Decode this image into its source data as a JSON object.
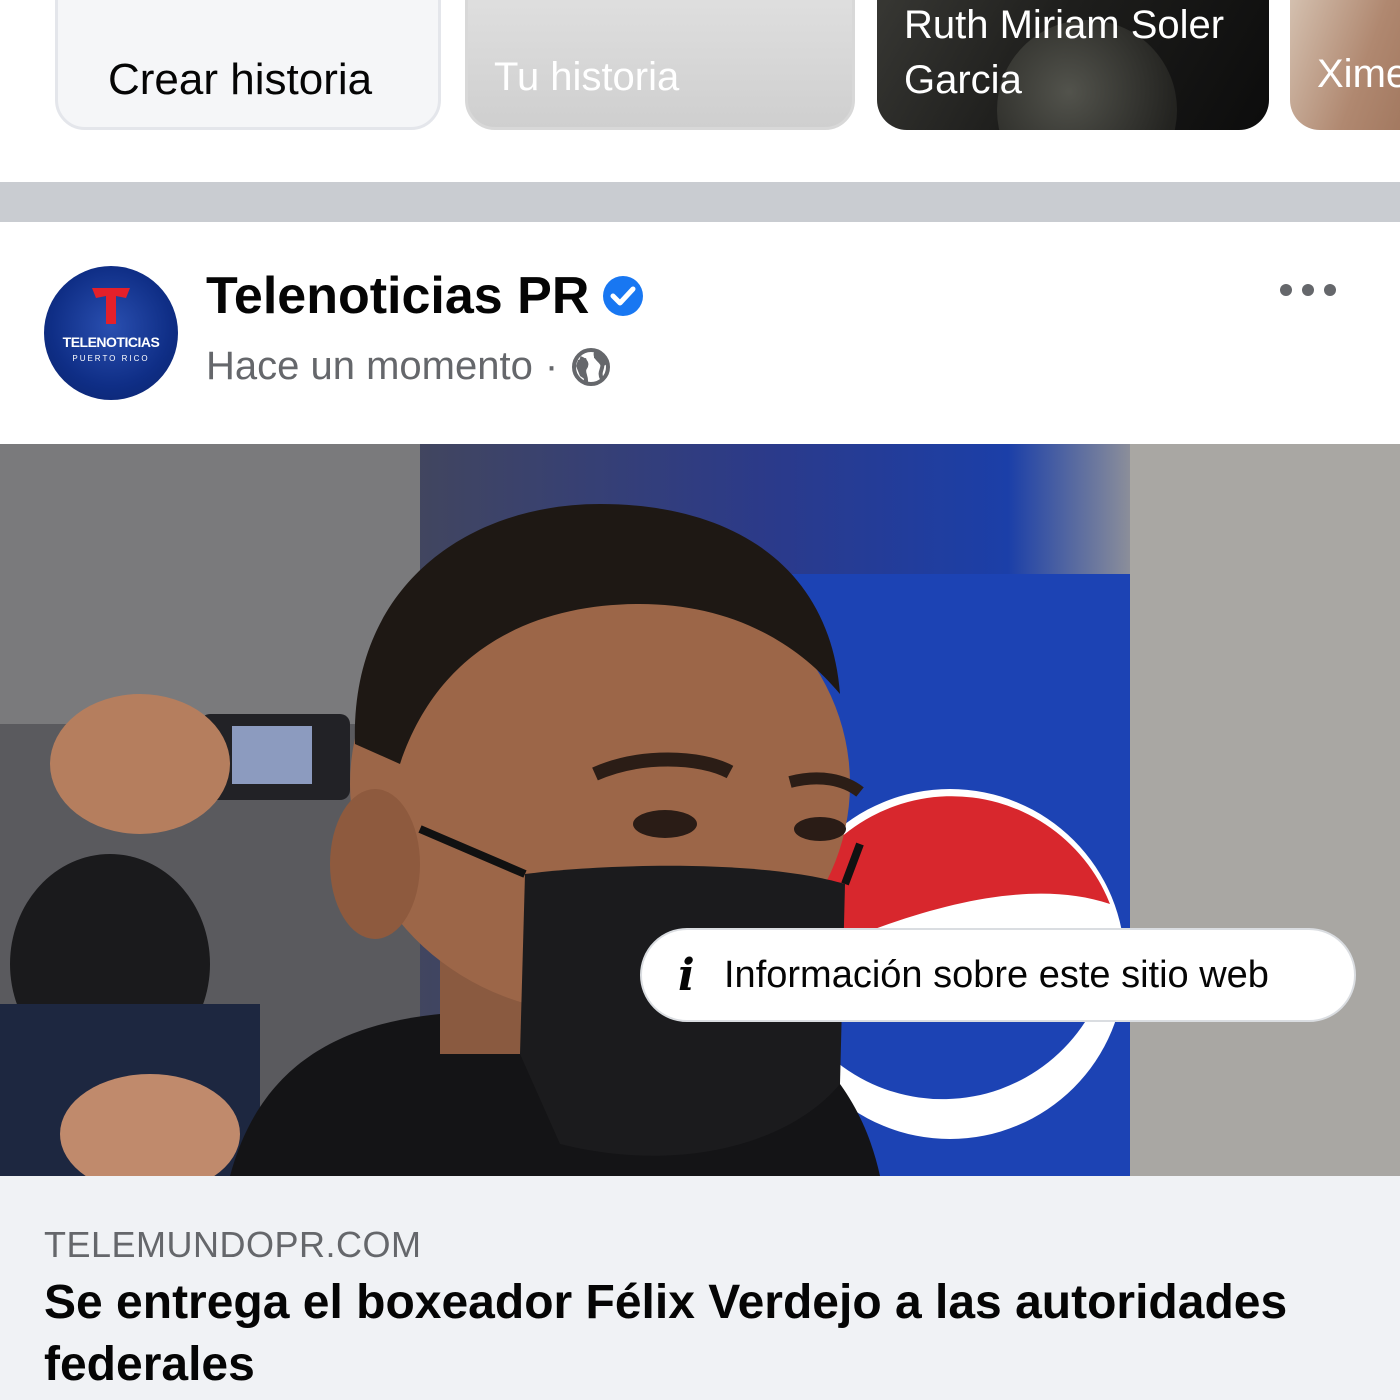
{
  "stories": {
    "create_label": "Crear historia",
    "yours_label": "Tu historia",
    "ruth_label": "Ruth Miriam Soler Garcia",
    "xime_label": "Xime"
  },
  "post": {
    "page_name": "Telenoticias PR",
    "timestamp": "Hace un momento",
    "separator": "·",
    "avatar_text": "TELENOTICIAS",
    "avatar_subtext": "PUERTO RICO",
    "info_label": "Información sobre este sitio web"
  },
  "link": {
    "domain": "TELEMUNDOPR.COM",
    "headline": "Se entrega el boxeador Félix Verdejo a las autoridades federales"
  },
  "colors": {
    "verified": "#1877f2",
    "text_primary": "#050505",
    "text_secondary": "#65676b",
    "link_bg": "#f0f2f5"
  }
}
